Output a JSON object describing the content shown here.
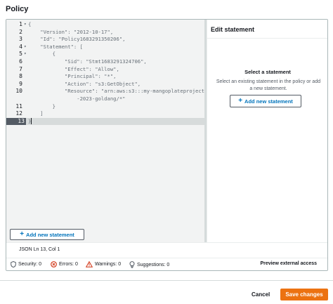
{
  "header": {
    "title": "Policy"
  },
  "editor": {
    "lines": [
      {
        "num": "1",
        "fold": "▾",
        "text": "{"
      },
      {
        "num": "2",
        "fold": "",
        "text": "    \"Version\": \"2012-10-17\","
      },
      {
        "num": "3",
        "fold": "",
        "text": "    \"Id\": \"Policy1683291350206\","
      },
      {
        "num": "4",
        "fold": "▾",
        "text": "    \"Statement\": ["
      },
      {
        "num": "5",
        "fold": "▾",
        "text": "        {"
      },
      {
        "num": "6",
        "fold": "",
        "text": "            \"Sid\": \"Stmt1683291324706\","
      },
      {
        "num": "7",
        "fold": "",
        "text": "            \"Effect\": \"Allow\","
      },
      {
        "num": "8",
        "fold": "",
        "text": "            \"Principal\": \"*\","
      },
      {
        "num": "9",
        "fold": "",
        "text": "            \"Action\": \"s3:GetObject\","
      },
      {
        "num": "10",
        "fold": "",
        "text": "            \"Resource\": \"arn:aws:s3:::my-mangoplateproject-bucket"
      },
      {
        "num": "",
        "fold": "",
        "text": "                -2023-goldang/*\""
      },
      {
        "num": "11",
        "fold": "",
        "text": "        }"
      },
      {
        "num": "12",
        "fold": "",
        "text": "    ]"
      },
      {
        "num": "13",
        "fold": "",
        "text": "}"
      }
    ],
    "add_statement_label": "Add new statement"
  },
  "side_panel": {
    "title": "Edit statement",
    "select_title": "Select a statement",
    "select_desc": "Select an existing statement in the policy or add a new statement.",
    "add_statement_label": "Add new statement"
  },
  "status_bar": {
    "info": "JSON   Ln 13, Col 1",
    "security": "Security: 0",
    "errors": "Errors: 0",
    "warnings": "Warnings: 0",
    "suggestions": "Suggestions: 0",
    "preview_label": "Preview external access"
  },
  "footer": {
    "cancel_label": "Cancel",
    "save_label": "Save changes"
  },
  "colors": {
    "primary": "#ec7211",
    "link": "#0073bb",
    "error": "#d13212",
    "warning": "#ff9900"
  }
}
